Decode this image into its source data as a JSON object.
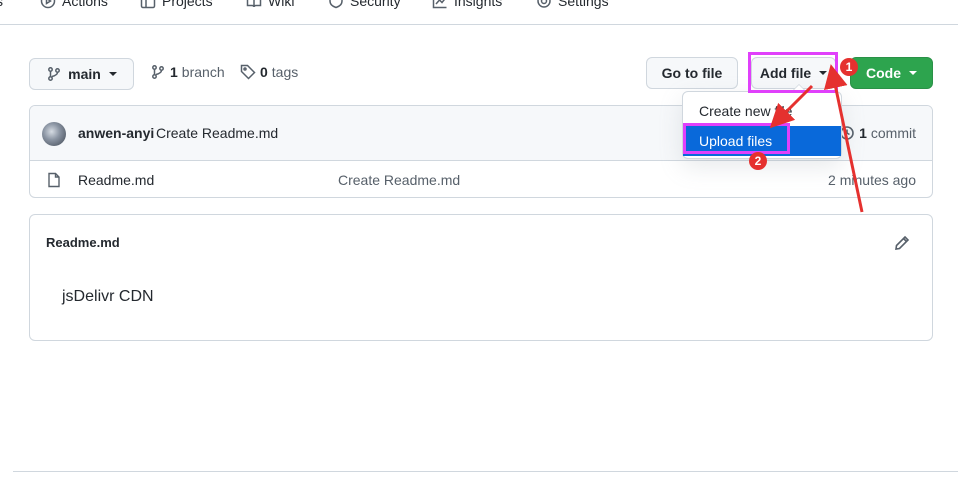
{
  "nav": {
    "items": [
      {
        "label": "s"
      },
      {
        "label": "Actions"
      },
      {
        "label": "Projects"
      },
      {
        "label": "Wiki"
      },
      {
        "label": "Security"
      },
      {
        "label": "Insights"
      },
      {
        "label": "Settings"
      }
    ]
  },
  "toolbar": {
    "branch_label": "main",
    "branches_count": "1",
    "branches_label": "branch",
    "tags_count": "0",
    "tags_label": "tags",
    "go_to_file_label": "Go to file",
    "add_file_label": "Add file",
    "code_label": "Code"
  },
  "dropdown": {
    "items": [
      {
        "label": "Create new file"
      },
      {
        "label": "Upload files"
      }
    ]
  },
  "commit": {
    "author": "anwen-anyi",
    "message": "Create Readme.md",
    "count": "1",
    "count_label": "commit"
  },
  "files": [
    {
      "name": "Readme.md",
      "commit_message": "Create Readme.md",
      "age": "2 minutes ago"
    }
  ],
  "readme": {
    "title": "Readme.md",
    "body": "jsDelivr CDN"
  },
  "annotations": {
    "step1": "1",
    "step2": "2"
  },
  "colors": {
    "code_button": "#2da44e",
    "highlight_box": "#e040fb",
    "arrow": "#e5312f",
    "selected_item": "#0969da"
  }
}
